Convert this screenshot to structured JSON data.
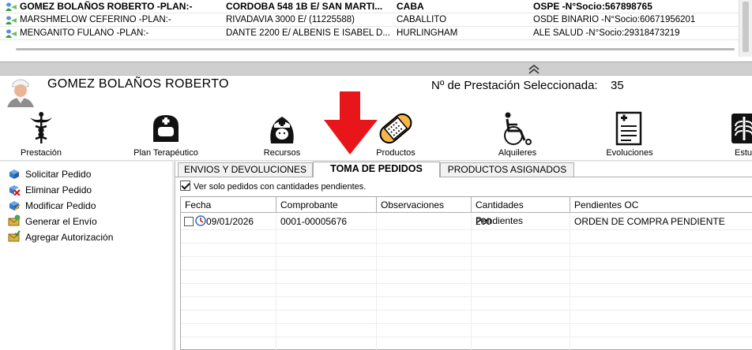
{
  "patients": [
    {
      "name": "GOMEZ BOLAÑOS ROBERTO -PLAN:-",
      "address": "CORDOBA 548 1B E/ SAN MARTI...",
      "city": "CABA",
      "coverage": "OSPE -N°Socio:567898765",
      "selected": true
    },
    {
      "name": "MARSHMELOW CEFERINO -PLAN:-",
      "address": "RIVADAVIA 3000  E/  (11225588)",
      "city": "CABALLITO",
      "coverage": "OSDE BINARIO -N°Socio:60671956201",
      "selected": false
    },
    {
      "name": "MENGANITO FULANO -PLAN:-",
      "address": "DANTE  2200  E/ ALBENIS E ISABEL D...",
      "city": "HURLINGHAM",
      "coverage": "ALE SALUD -N°Socio:29318473219",
      "selected": false
    }
  ],
  "header": {
    "patient_name": "GOMEZ BOLAÑOS ROBERTO",
    "prestacion_label": "Nº de Prestación Seleccionada:",
    "prestacion_value": "35"
  },
  "toolbar": [
    {
      "label": "Prestación",
      "icon": "caduceus-icon"
    },
    {
      "label": "Plan Terapéutico",
      "icon": "nurse-helmet-icon"
    },
    {
      "label": "Recursos",
      "icon": "nurse-icon"
    },
    {
      "label": "Productos",
      "icon": "bandage-icon"
    },
    {
      "label": "Alquileres",
      "icon": "wheelchair-icon"
    },
    {
      "label": "Evoluciones",
      "icon": "medical-report-icon"
    },
    {
      "label": "Estu",
      "icon": "xray-icon"
    }
  ],
  "actions": [
    {
      "label": "Solicitar Pedido",
      "icon": "add-order-icon"
    },
    {
      "label": "Eliminar Pedido",
      "icon": "delete-order-icon"
    },
    {
      "label": "Modificar Pedido",
      "icon": "edit-order-icon"
    },
    {
      "label": "Generar el Envío",
      "icon": "send-icon"
    },
    {
      "label": "Agregar Autorización",
      "icon": "authorization-icon"
    }
  ],
  "tabs": [
    {
      "label": "ENVIOS Y DEVOLUCIONES",
      "active": false
    },
    {
      "label": "TOMA DE PEDIDOS",
      "active": true
    },
    {
      "label": "PRODUCTOS ASIGNADOS",
      "active": false
    }
  ],
  "filter": {
    "label": "Ver solo pedidos con cantidades pendientes.",
    "checked": true
  },
  "table": {
    "columns": [
      "Fecha",
      "Comprobante",
      "Observaciones",
      "Cantidades Pendientes",
      "Pendientes OC"
    ],
    "rows": [
      {
        "fecha": "09/01/2026",
        "comprobante": "0001-00005676",
        "observaciones": "",
        "cantidades": "200",
        "pendientes_oc": "ORDEN DE COMPRA PENDIENTE"
      }
    ]
  },
  "colors": {
    "accent_red": "#e8161b",
    "selection_bold": "#000000"
  }
}
